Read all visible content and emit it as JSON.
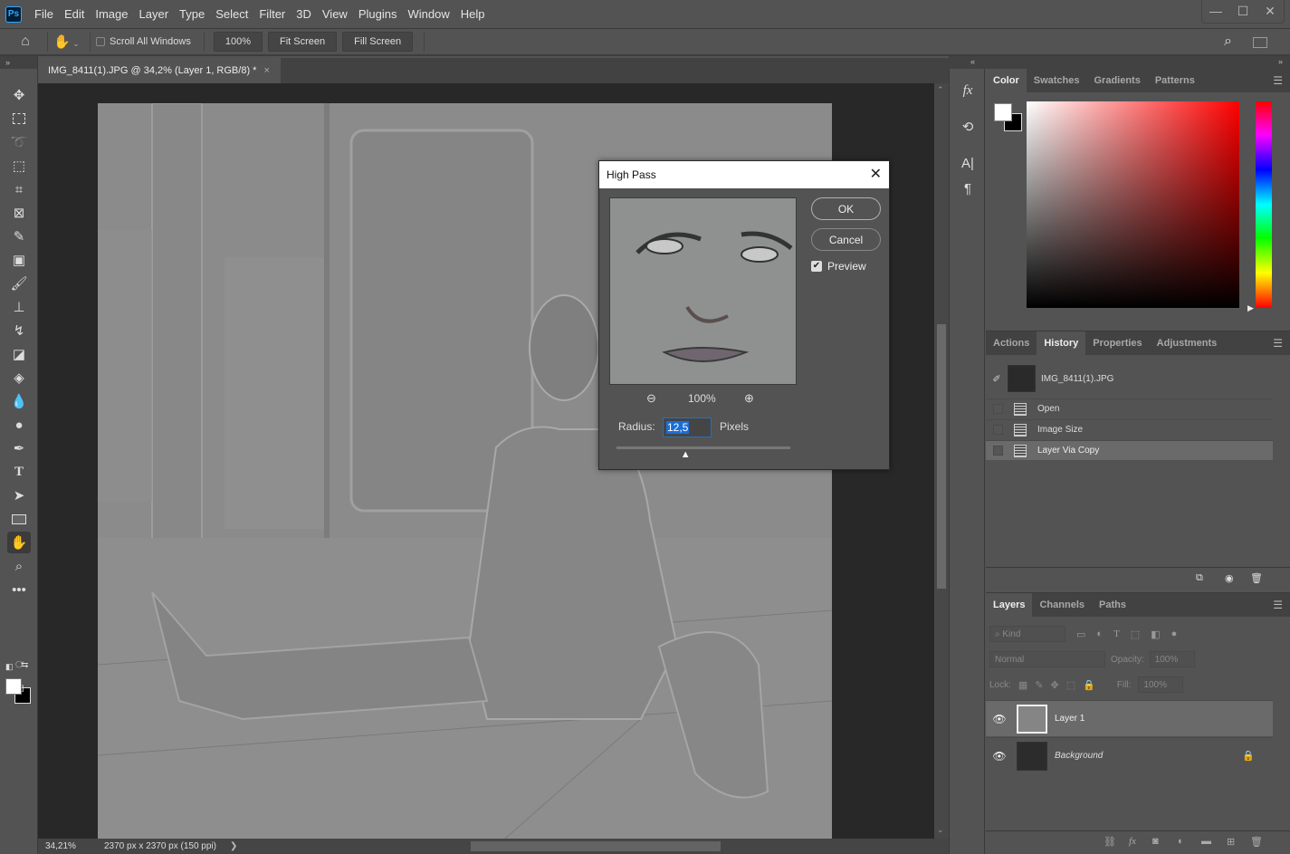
{
  "app": {
    "logo": "Ps",
    "menu": [
      "File",
      "Edit",
      "Image",
      "Layer",
      "Type",
      "Select",
      "Filter",
      "3D",
      "View",
      "Plugins",
      "Window",
      "Help"
    ],
    "window_controls": {
      "minimize": "—",
      "maximize": "☐",
      "close": "✕"
    }
  },
  "options_bar": {
    "scroll_all_windows_label": "Scroll All Windows",
    "scroll_all_windows_checked": false,
    "zoom_100_label": "100%",
    "fit_screen_label": "Fit Screen",
    "fill_screen_label": "Fill Screen"
  },
  "document": {
    "tab_title": "IMG_8411(1).JPG @ 34,2% (Layer 1, RGB/8) *",
    "tab_close": "×",
    "zoom_level": "34,21%",
    "doc_info": "2370 px x 2370 px (150 ppi)",
    "status_arrow": "❯"
  },
  "toolbox": {
    "tools": [
      "move",
      "rectangular-marquee",
      "lasso",
      "object-selection",
      "crop",
      "frame",
      "eyedropper",
      "spot-healing",
      "brush",
      "clone-stamp",
      "history-brush",
      "eraser",
      "paint-bucket",
      "blur",
      "dodge",
      "pen",
      "type",
      "path-selection",
      "rectangle",
      "hand",
      "zoom",
      "edit-toolbar"
    ],
    "active_tool": "hand",
    "foreground_color": "#ffffff",
    "background_color": "#000000"
  },
  "dialog": {
    "title": "High Pass",
    "ok_label": "OK",
    "cancel_label": "Cancel",
    "preview_label": "Preview",
    "preview_checked": true,
    "preview_zoom": "100%",
    "radius_label": "Radius:",
    "radius_value": "12,5",
    "radius_unit": "Pixels",
    "radius_slider_fraction": 0.4
  },
  "color_panel": {
    "tabs": [
      "Color",
      "Swatches",
      "Gradients",
      "Patterns"
    ],
    "active_tab": "Color",
    "hue_color": "#ff0000"
  },
  "history_panel": {
    "tabs": [
      "Actions",
      "History",
      "Properties",
      "Adjustments"
    ],
    "active_tab": "History",
    "snapshot_label": "IMG_8411(1).JPG",
    "items": [
      {
        "label": "Open",
        "selected": false
      },
      {
        "label": "Image Size",
        "selected": false
      },
      {
        "label": "Layer Via Copy",
        "selected": true
      }
    ]
  },
  "layers_panel": {
    "tabs": [
      "Layers",
      "Channels",
      "Paths"
    ],
    "active_tab": "Layers",
    "filter_placeholder": "Kind",
    "blend_mode": "Normal",
    "opacity_label": "Opacity:",
    "opacity_value": "100%",
    "lock_label": "Lock:",
    "fill_label": "Fill:",
    "fill_value": "100%",
    "layers": [
      {
        "name": "Layer 1",
        "selected": true,
        "visible": true,
        "locked": false
      },
      {
        "name": "Background",
        "selected": false,
        "visible": true,
        "locked": true
      }
    ]
  }
}
